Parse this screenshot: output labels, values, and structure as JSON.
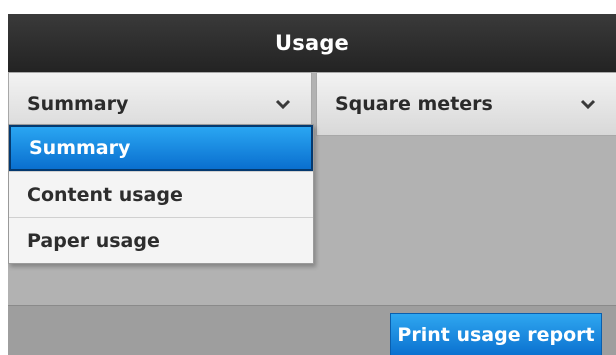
{
  "window": {
    "title": "Usage"
  },
  "filters": {
    "view_select": {
      "selected": "Summary",
      "icon": "chevron-down-icon"
    },
    "unit_select": {
      "selected": "Square meters",
      "icon": "chevron-down-icon"
    }
  },
  "view_menu": {
    "items": [
      {
        "label": "Summary",
        "selected": true
      },
      {
        "label": "Content usage",
        "selected": false
      },
      {
        "label": "Paper usage",
        "selected": false
      }
    ]
  },
  "footer": {
    "print_button_label": "Print usage report"
  },
  "colors": {
    "accent": "#0a70cf",
    "titlebar": "#2a2a2a",
    "background": "#b2b2b2"
  }
}
